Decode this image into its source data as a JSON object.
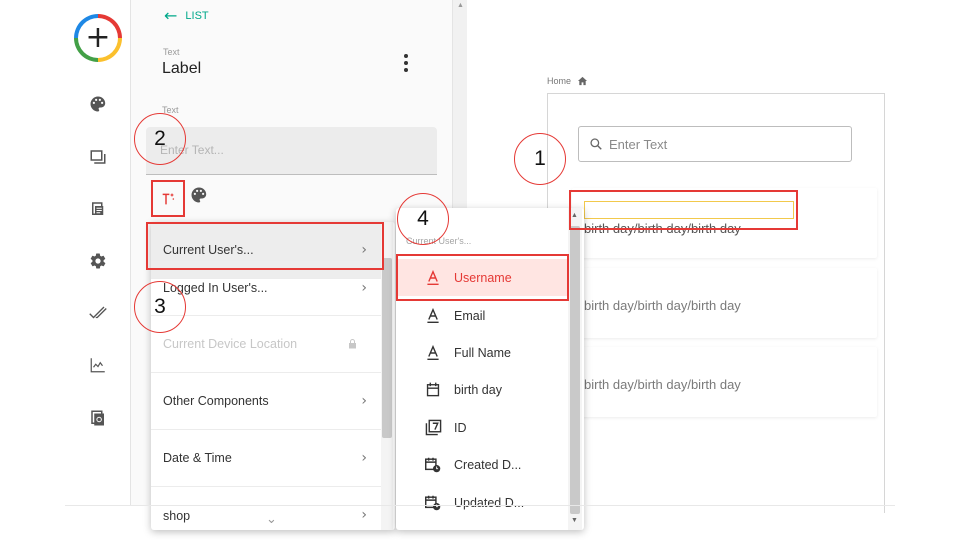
{
  "rail": {
    "add_icon": "plus-icon",
    "icons": [
      "palette-icon",
      "screens-icon",
      "database-icon",
      "settings-icon",
      "publish-check-icon",
      "analytics-icon",
      "app-settings-icon"
    ]
  },
  "panel": {
    "back_label": "LIST",
    "component_type": "Text",
    "component_name": "Label",
    "text_field_label": "Text",
    "text_field_placeholder": "Enter Text..."
  },
  "menu1": {
    "items": [
      {
        "label": "Current User's...",
        "state": "active"
      },
      {
        "label": "Logged In User's...",
        "state": "normal"
      },
      {
        "label": "Current Device Location",
        "state": "disabled"
      },
      {
        "label": "Other Components",
        "state": "normal"
      },
      {
        "label": "Date & Time",
        "state": "normal"
      },
      {
        "label": "shop",
        "state": "normal"
      }
    ]
  },
  "menu2": {
    "header": "Current User's...",
    "items": [
      {
        "label": "Username",
        "icon": "text-format-icon",
        "selected": true
      },
      {
        "label": "Email",
        "icon": "text-format-icon",
        "selected": false
      },
      {
        "label": "Full Name",
        "icon": "text-format-icon",
        "selected": false
      },
      {
        "label": "birth day",
        "icon": "calendar-icon",
        "selected": false
      },
      {
        "label": "ID",
        "icon": "id-number-icon",
        "selected": false
      },
      {
        "label": "Created D...",
        "icon": "calendar-clock-icon",
        "selected": false
      },
      {
        "label": "Updated D...",
        "icon": "calendar-clock-icon",
        "selected": false
      }
    ]
  },
  "canvas": {
    "breadcrumb": "Home",
    "search_placeholder": "Enter Text",
    "list_items": [
      "birth day/birth day/birth day",
      "birth day/birth day/birth day",
      "birth day/birth day/birth day"
    ]
  },
  "annotations": {
    "steps": [
      "1",
      "2",
      "3",
      "4"
    ],
    "color": "#e53935"
  },
  "colors": {
    "accent": "#00a88a",
    "highlight": "#e53935",
    "selected_bg": "#ffe5e2"
  }
}
